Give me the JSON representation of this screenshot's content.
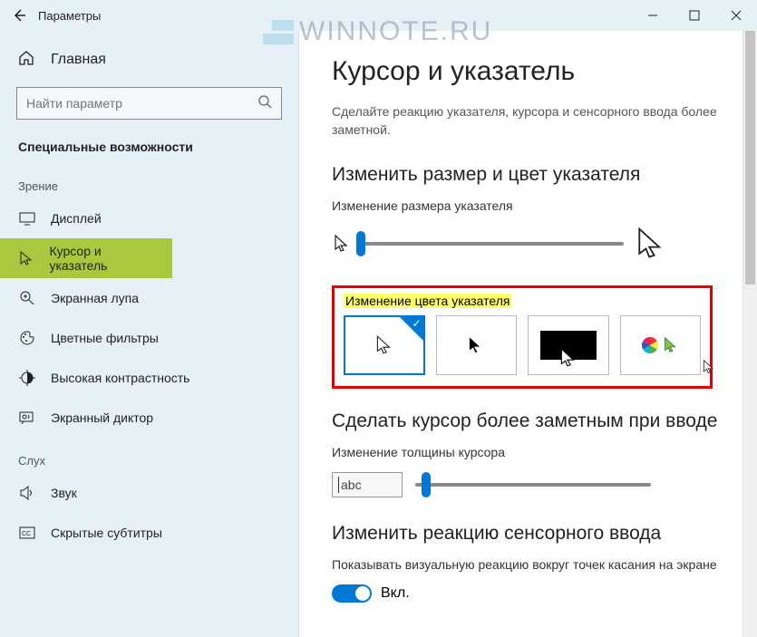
{
  "window": {
    "title": "Параметры"
  },
  "watermark": "WINNOTE.RU",
  "sidebar": {
    "home": "Главная",
    "search_placeholder": "Найти параметр",
    "section": "Специальные возможности",
    "groups": [
      {
        "label": "Зрение",
        "items": [
          {
            "icon": "display-icon",
            "label": "Дисплей",
            "selected": false
          },
          {
            "icon": "cursor-icon",
            "label": "Курсор и указатель",
            "selected": true
          },
          {
            "icon": "magnifier-icon",
            "label": "Экранная лупа",
            "selected": false
          },
          {
            "icon": "palette-icon",
            "label": "Цветные фильтры",
            "selected": false
          },
          {
            "icon": "contrast-icon",
            "label": "Высокая контрастность",
            "selected": false
          },
          {
            "icon": "narrator-icon",
            "label": "Экранный диктор",
            "selected": false
          }
        ]
      },
      {
        "label": "Слух",
        "items": [
          {
            "icon": "sound-icon",
            "label": "Звук",
            "selected": false
          },
          {
            "icon": "cc-icon",
            "label": "Скрытые субтитры",
            "selected": false
          }
        ]
      }
    ]
  },
  "main": {
    "heading": "Курсор и указатель",
    "description": "Сделайте реакцию указателя, курсора и сенсорного ввода более заметной.",
    "section_size": {
      "heading": "Изменить размер и цвет указателя",
      "size_label": "Изменение размера указателя",
      "color_label": "Изменение цвета указателя",
      "color_options": [
        "white",
        "black",
        "inverted",
        "custom"
      ]
    },
    "section_cursor": {
      "heading": "Сделать курсор более заметным при вводе",
      "thickness_label": "Изменение толщины курсора",
      "preview_text": "abc"
    },
    "section_touch": {
      "heading": "Изменить реакцию сенсорного ввода",
      "toggle_label": "Показывать визуальную реакцию вокруг точек касания на экране",
      "toggle_state": "Вкл."
    }
  }
}
